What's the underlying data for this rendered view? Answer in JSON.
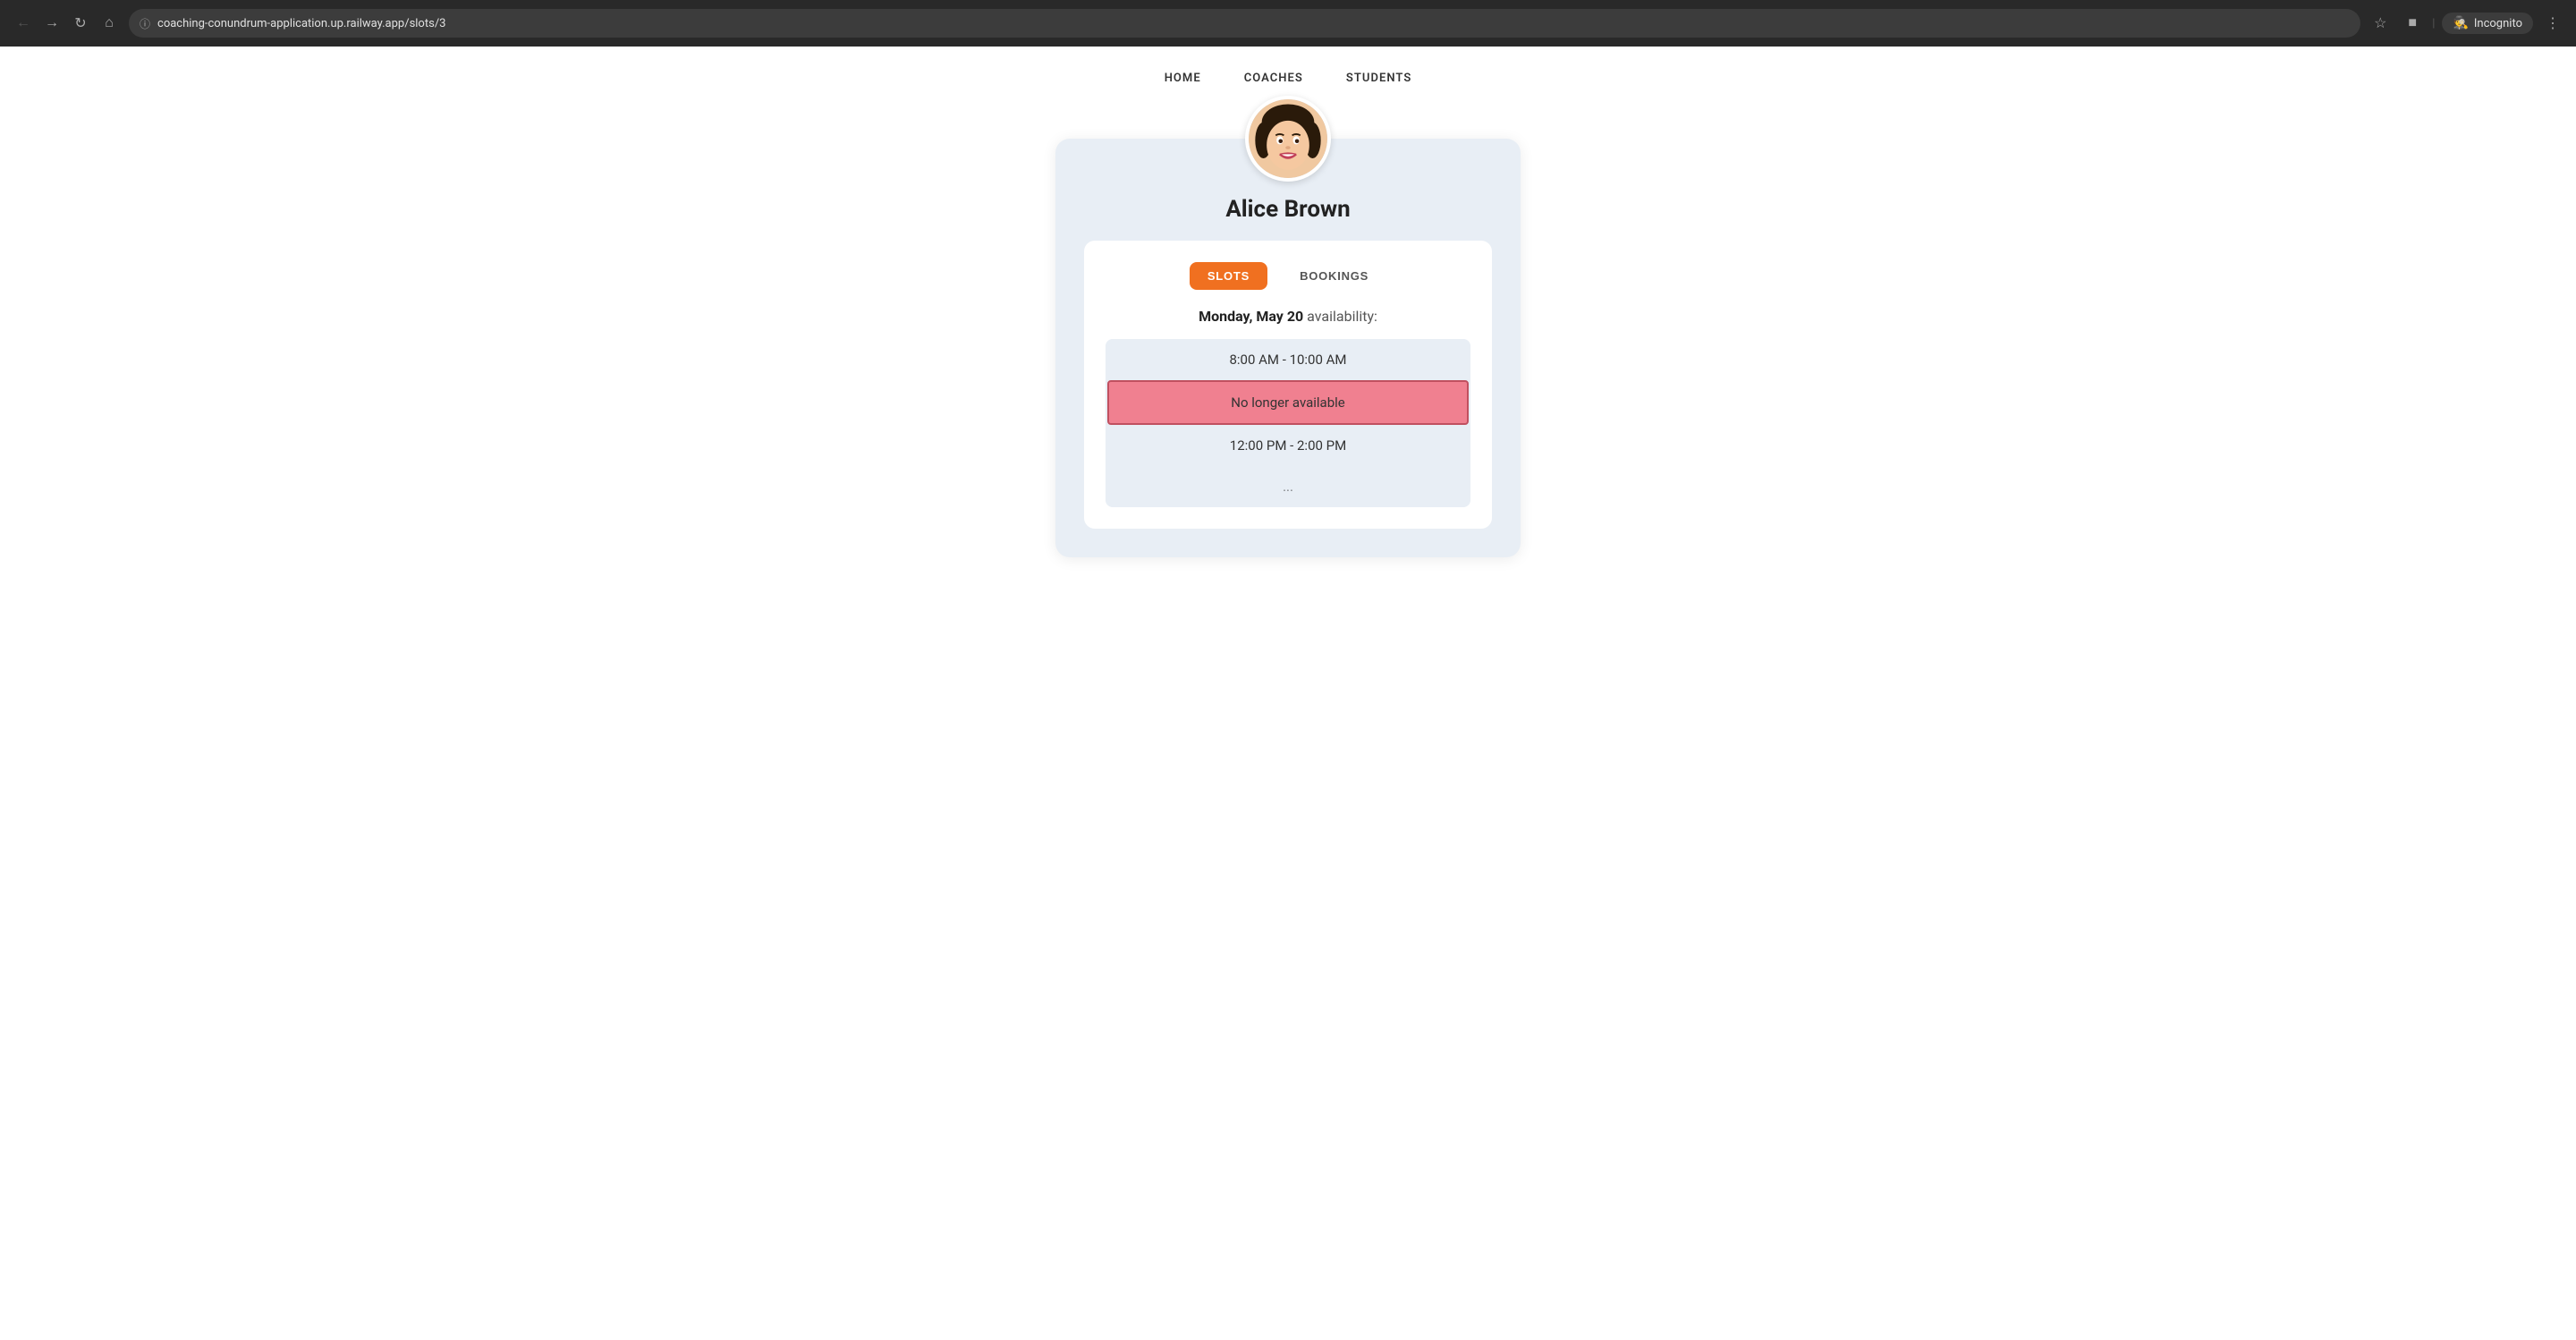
{
  "browser": {
    "url": "coaching-conundrum-application.up.railway.app/slots/3",
    "incognito_label": "Incognito"
  },
  "nav": {
    "home_label": "HOME",
    "coaches_label": "COACHES",
    "students_label": "STUDENTS"
  },
  "coach": {
    "name": "Alice Brown"
  },
  "tabs": {
    "slots_label": "SLOTS",
    "bookings_label": "BOOKINGS"
  },
  "availability": {
    "day": "Monday, May 20",
    "suffix": " availability:"
  },
  "slots": [
    {
      "time": "8:00 AM - 10:00 AM",
      "status": "normal"
    },
    {
      "time": "No longer available",
      "status": "unavailable"
    },
    {
      "time": "12:00 PM - 2:00 PM",
      "status": "normal"
    },
    {
      "time": "...",
      "status": "partial"
    }
  ]
}
